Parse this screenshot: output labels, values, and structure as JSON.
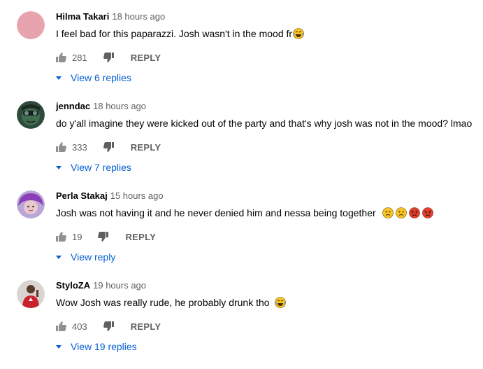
{
  "colors": {
    "link": "#065fd4",
    "meta": "#606060",
    "text": "#030303"
  },
  "comments": [
    {
      "author": "Hilma Takari",
      "time": "18 hours ago",
      "text": "I feel bad for this paparazzi. Josh wasn't in the mood fr",
      "emojis": [
        "tears-of-joy-emoji"
      ],
      "likes": "281",
      "reply_label": "REPLY",
      "view_replies": "View 6 replies",
      "avatar": "pink-circle-avatar"
    },
    {
      "author": "jenndac",
      "time": "18 hours ago",
      "text": "do y'all imagine they were kicked out of the party and that's why josh was not in the mood? lmao",
      "emojis": [],
      "likes": "333",
      "reply_label": "REPLY",
      "view_replies": "View 7 replies",
      "avatar": "green-face-avatar"
    },
    {
      "author": "Perla Stakaj",
      "time": "15 hours ago",
      "text": "Josh was not having it and he never denied him and nessa being together",
      "emojis": [
        "confused-emoji",
        "confused-emoji",
        "angry-emoji",
        "angry-emoji"
      ],
      "likes": "19",
      "reply_label": "REPLY",
      "view_replies": "View reply",
      "avatar": "purple-hair-avatar"
    },
    {
      "author": "StyloZA",
      "time": "19 hours ago",
      "text": "Wow Josh was really rude, he probably drunk tho",
      "emojis": [
        "tears-of-joy-emoji"
      ],
      "likes": "403",
      "reply_label": "REPLY",
      "view_replies": "View 19 replies",
      "avatar": "red-shirt-avatar"
    }
  ]
}
